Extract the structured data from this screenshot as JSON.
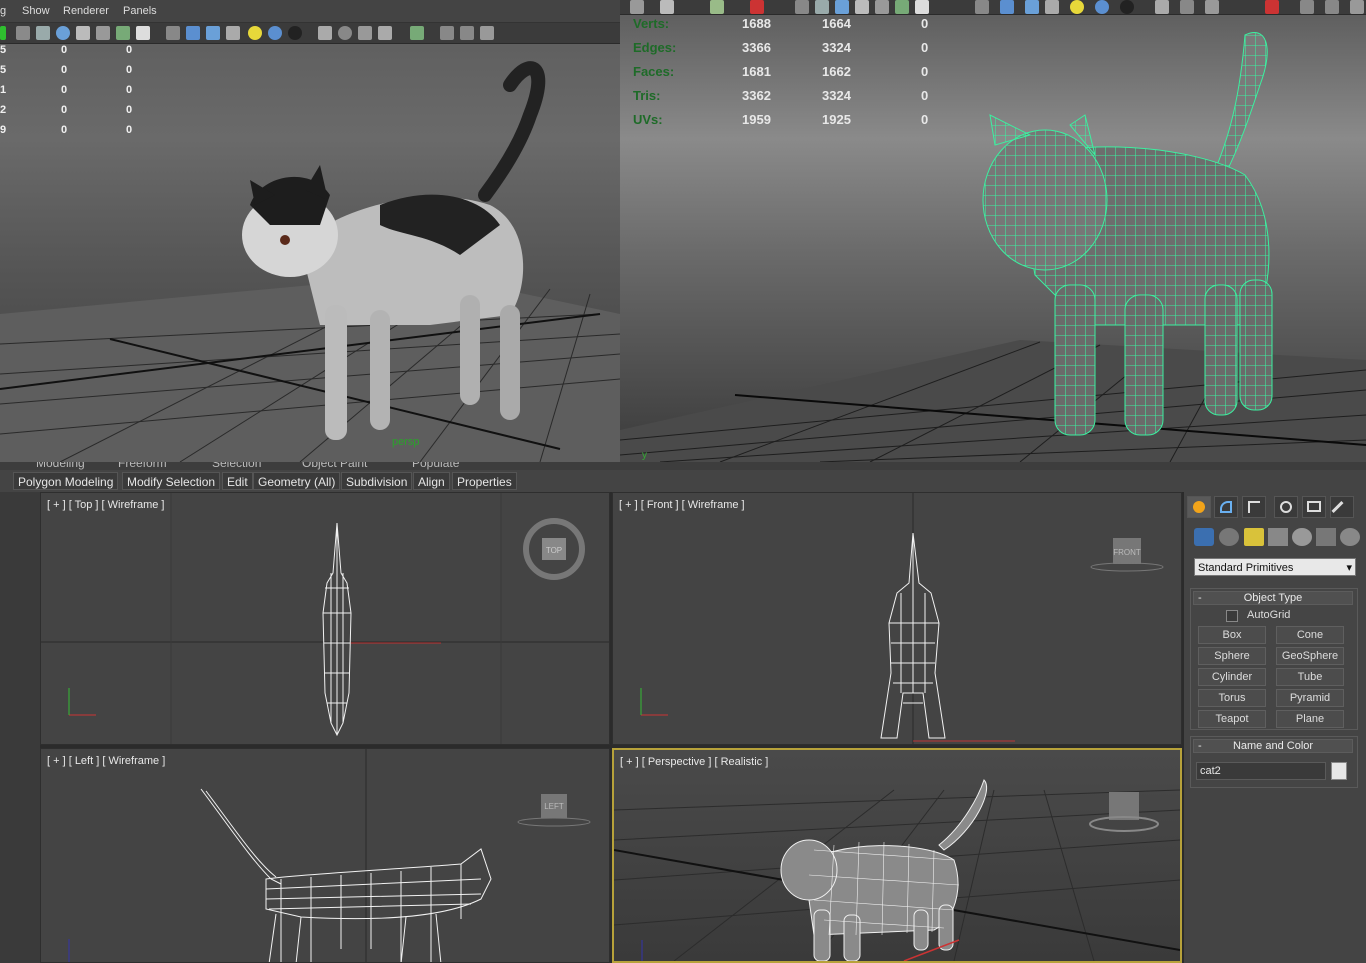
{
  "maya_left": {
    "menu": [
      "g",
      "Show",
      "Renderer",
      "Panels"
    ],
    "hud_rows": [
      [
        "5",
        "0",
        "0"
      ],
      [
        "5",
        "0",
        "0"
      ],
      [
        "1",
        "0",
        "0"
      ],
      [
        "2",
        "0",
        "0"
      ],
      [
        "9",
        "0",
        "0"
      ]
    ],
    "camera_label": "persp"
  },
  "maya_right": {
    "stats": [
      {
        "label": "Verts:",
        "values": [
          "1688",
          "1664",
          "0"
        ]
      },
      {
        "label": "Edges:",
        "values": [
          "3366",
          "3324",
          "0"
        ]
      },
      {
        "label": "Faces:",
        "values": [
          "1681",
          "1662",
          "0"
        ]
      },
      {
        "label": "Tris:",
        "values": [
          "3362",
          "3324",
          "0"
        ]
      },
      {
        "label": "UVs:",
        "values": [
          "1959",
          "1925",
          "0"
        ]
      }
    ]
  },
  "max": {
    "ribbon_tabs": [
      "Modeling",
      "Freeform",
      "Selection",
      "Object Paint",
      "Populate"
    ],
    "ribbon_items": [
      "Polygon Modeling",
      "Modify Selection",
      "Edit",
      "Geometry (All)",
      "Subdivision",
      "Align",
      "Properties"
    ],
    "viewports": {
      "top": "[ + ] [ Top ] [ Wireframe ]",
      "front": "[ + ] [ Front ] [ Wireframe ]",
      "left": "[ + ] [ Left ] [ Wireframe ]",
      "perspective": "[ + ] [ Perspective ] [ Realistic ]"
    },
    "viewcube": {
      "top": "TOP",
      "front": "FRONT",
      "left": "LEFT"
    },
    "command_panel": {
      "category": "Standard Primitives",
      "object_type_title": "Object Type",
      "autogrid": "AutoGrid",
      "buttons": [
        "Box",
        "Cone",
        "Sphere",
        "GeoSphere",
        "Cylinder",
        "Tube",
        "Torus",
        "Pyramid",
        "Teapot",
        "Plane"
      ],
      "name_color_title": "Name and Color",
      "object_name": "cat2",
      "collapse_symbol": "-"
    }
  }
}
